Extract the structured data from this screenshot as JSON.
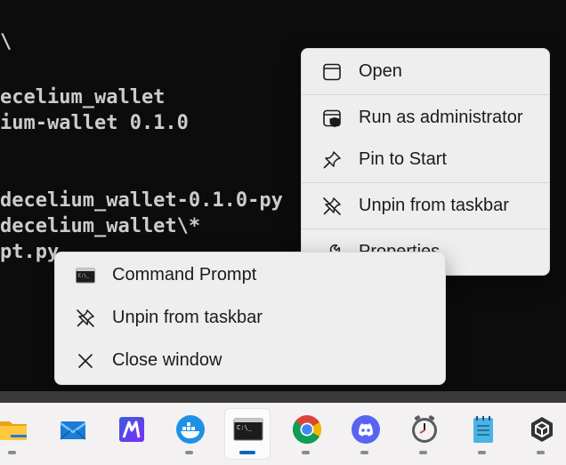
{
  "terminal": {
    "lines": [
      "\\",
      "ecelium_wallet",
      "ium-wallet 0.1.0",
      "decelium_wallet-0.1.0-py",
      "decelium_wallet\\*",
      "pt.py"
    ]
  },
  "context_menu_app": {
    "items": [
      {
        "label": "Open",
        "icon": "window-icon"
      },
      {
        "label": "Run as administrator",
        "icon": "shield-icon"
      },
      {
        "label": "Pin to Start",
        "icon": "pin-icon"
      },
      {
        "label": "Unpin from taskbar",
        "icon": "unpin-icon"
      },
      {
        "label": "Properties",
        "icon": "wrench-icon"
      }
    ]
  },
  "context_menu_window": {
    "items": [
      {
        "label": "Command Prompt",
        "icon": "command-prompt-icon"
      },
      {
        "label": "Unpin from taskbar",
        "icon": "unpin-icon"
      },
      {
        "label": "Close window",
        "icon": "close-icon"
      }
    ]
  },
  "taskbar": {
    "items": [
      {
        "name": "File Explorer",
        "icon": "folder-icon"
      },
      {
        "name": "Mail",
        "icon": "mail-icon"
      },
      {
        "name": "Malwarebytes",
        "icon": "malwarebytes-icon"
      },
      {
        "name": "Docker Desktop",
        "icon": "docker-icon"
      },
      {
        "name": "Command Prompt",
        "icon": "command-prompt-icon",
        "active": true
      },
      {
        "name": "Google Chrome",
        "icon": "chrome-icon"
      },
      {
        "name": "Discord",
        "icon": "discord-icon"
      },
      {
        "name": "Clock",
        "icon": "clock-icon"
      },
      {
        "name": "Notepad",
        "icon": "notepad-icon"
      },
      {
        "name": "Unity",
        "icon": "unity-icon"
      }
    ]
  },
  "colors": {
    "terminal_bg": "#0c0c0c",
    "terminal_text": "#cccccc",
    "menu_bg": "#eeeeee",
    "taskbar_bg": "#f3f1f1",
    "accent": "#0067c0"
  }
}
